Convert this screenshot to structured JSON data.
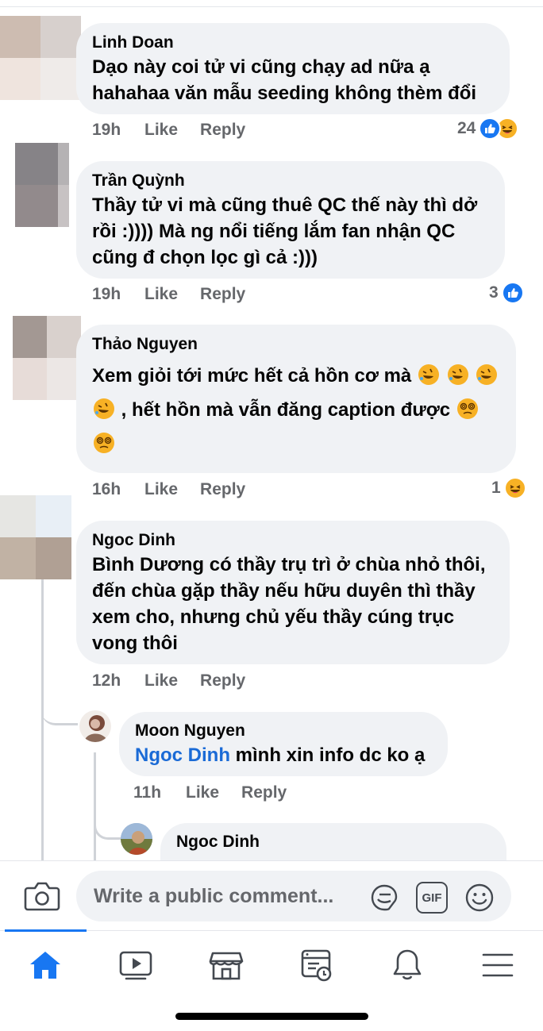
{
  "comments": [
    {
      "author": "Linh Doan",
      "text_lines": [
        "Dạo này coi tử vi cũng chạy ad nữa ạ",
        "hahahaa văn mẫu seeding không thèm đổi"
      ],
      "time": "19h",
      "like_label": "Like",
      "reply_label": "Reply",
      "reaction_count": "24",
      "reactions": [
        "like",
        "haha"
      ]
    },
    {
      "author": "Trần Quỳnh",
      "text_lines": [
        "Thầy tử vi mà cũng thuê QC thế này thì dở",
        "rồi :)))) Mà ng nổi tiếng lắm fan nhận QC",
        "cũng đ chọn lọc gì cả :)))"
      ],
      "time": "19h",
      "like_label": "Like",
      "reply_label": "Reply",
      "reaction_count": "3",
      "reactions": [
        "like"
      ]
    },
    {
      "author": "Thảo Nguyen",
      "text_line1": "Xem giỏi tới mức hết cả hồn cơ mà",
      "text_line2": ", hết hồn mà vẫn đăng caption được",
      "time": "16h",
      "like_label": "Like",
      "reply_label": "Reply",
      "reaction_count": "1",
      "reactions": [
        "haha"
      ]
    },
    {
      "author": "Ngoc Dinh",
      "text_lines": [
        "Bình Dương có thầy trụ trì ở chùa nhỏ thôi,",
        "đến chùa gặp thầy nếu hữu duyên thì thầy",
        "xem cho, nhưng chủ yếu thầy cúng trục",
        "vong thôi"
      ],
      "time": "12h",
      "like_label": "Like",
      "reply_label": "Reply"
    }
  ],
  "replies": [
    {
      "author": "Moon Nguyen",
      "mention": "Ngoc Dinh",
      "text": " mình xin info dc ko ạ",
      "time": "11h",
      "like_label": "Like",
      "reply_label": "Reply"
    },
    {
      "author": "Ngoc Dinh"
    }
  ],
  "composer": {
    "placeholder": "Write a public comment...",
    "gif_label": "GIF"
  },
  "nav": {
    "items": [
      "home-icon",
      "watch-icon",
      "marketplace-icon",
      "news-icon",
      "notifications-icon",
      "menu-icon"
    ],
    "active": "home"
  },
  "colors": {
    "accent": "#1877f2",
    "bubble": "#f0f2f5",
    "secondary_text": "#65676b",
    "mention": "#1a6ad6"
  }
}
